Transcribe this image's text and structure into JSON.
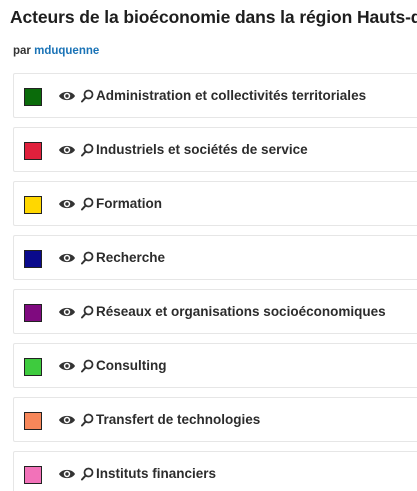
{
  "header": {
    "title": "Acteurs de la bioéconomie dans la région Hauts-de-France",
    "by_prefix": "par",
    "author": "mduquenne"
  },
  "layers": [
    {
      "label": "Administration et collectivités territoriales",
      "color": "#0a6b0a",
      "icon": "eye-icon"
    },
    {
      "label": "Industriels et sociétés de service",
      "color": "#e0203c",
      "icon": "eye-icon"
    },
    {
      "label": "Formation",
      "color": "#ffd700",
      "icon": "eye-icon"
    },
    {
      "label": "Recherche",
      "color": "#0a0a8c",
      "icon": "eye-icon"
    },
    {
      "label": "Réseaux et organisations socioéconomiques",
      "color": "#7f0a7f",
      "icon": "eye-icon"
    },
    {
      "label": "Consulting",
      "color": "#3ecb3e",
      "icon": "eye-icon"
    },
    {
      "label": "Transfert de technologies",
      "color": "#f7875a",
      "icon": "eye-icon"
    },
    {
      "label": "Instituts financiers",
      "color": "#f272b9",
      "icon": "eye-icon"
    }
  ]
}
